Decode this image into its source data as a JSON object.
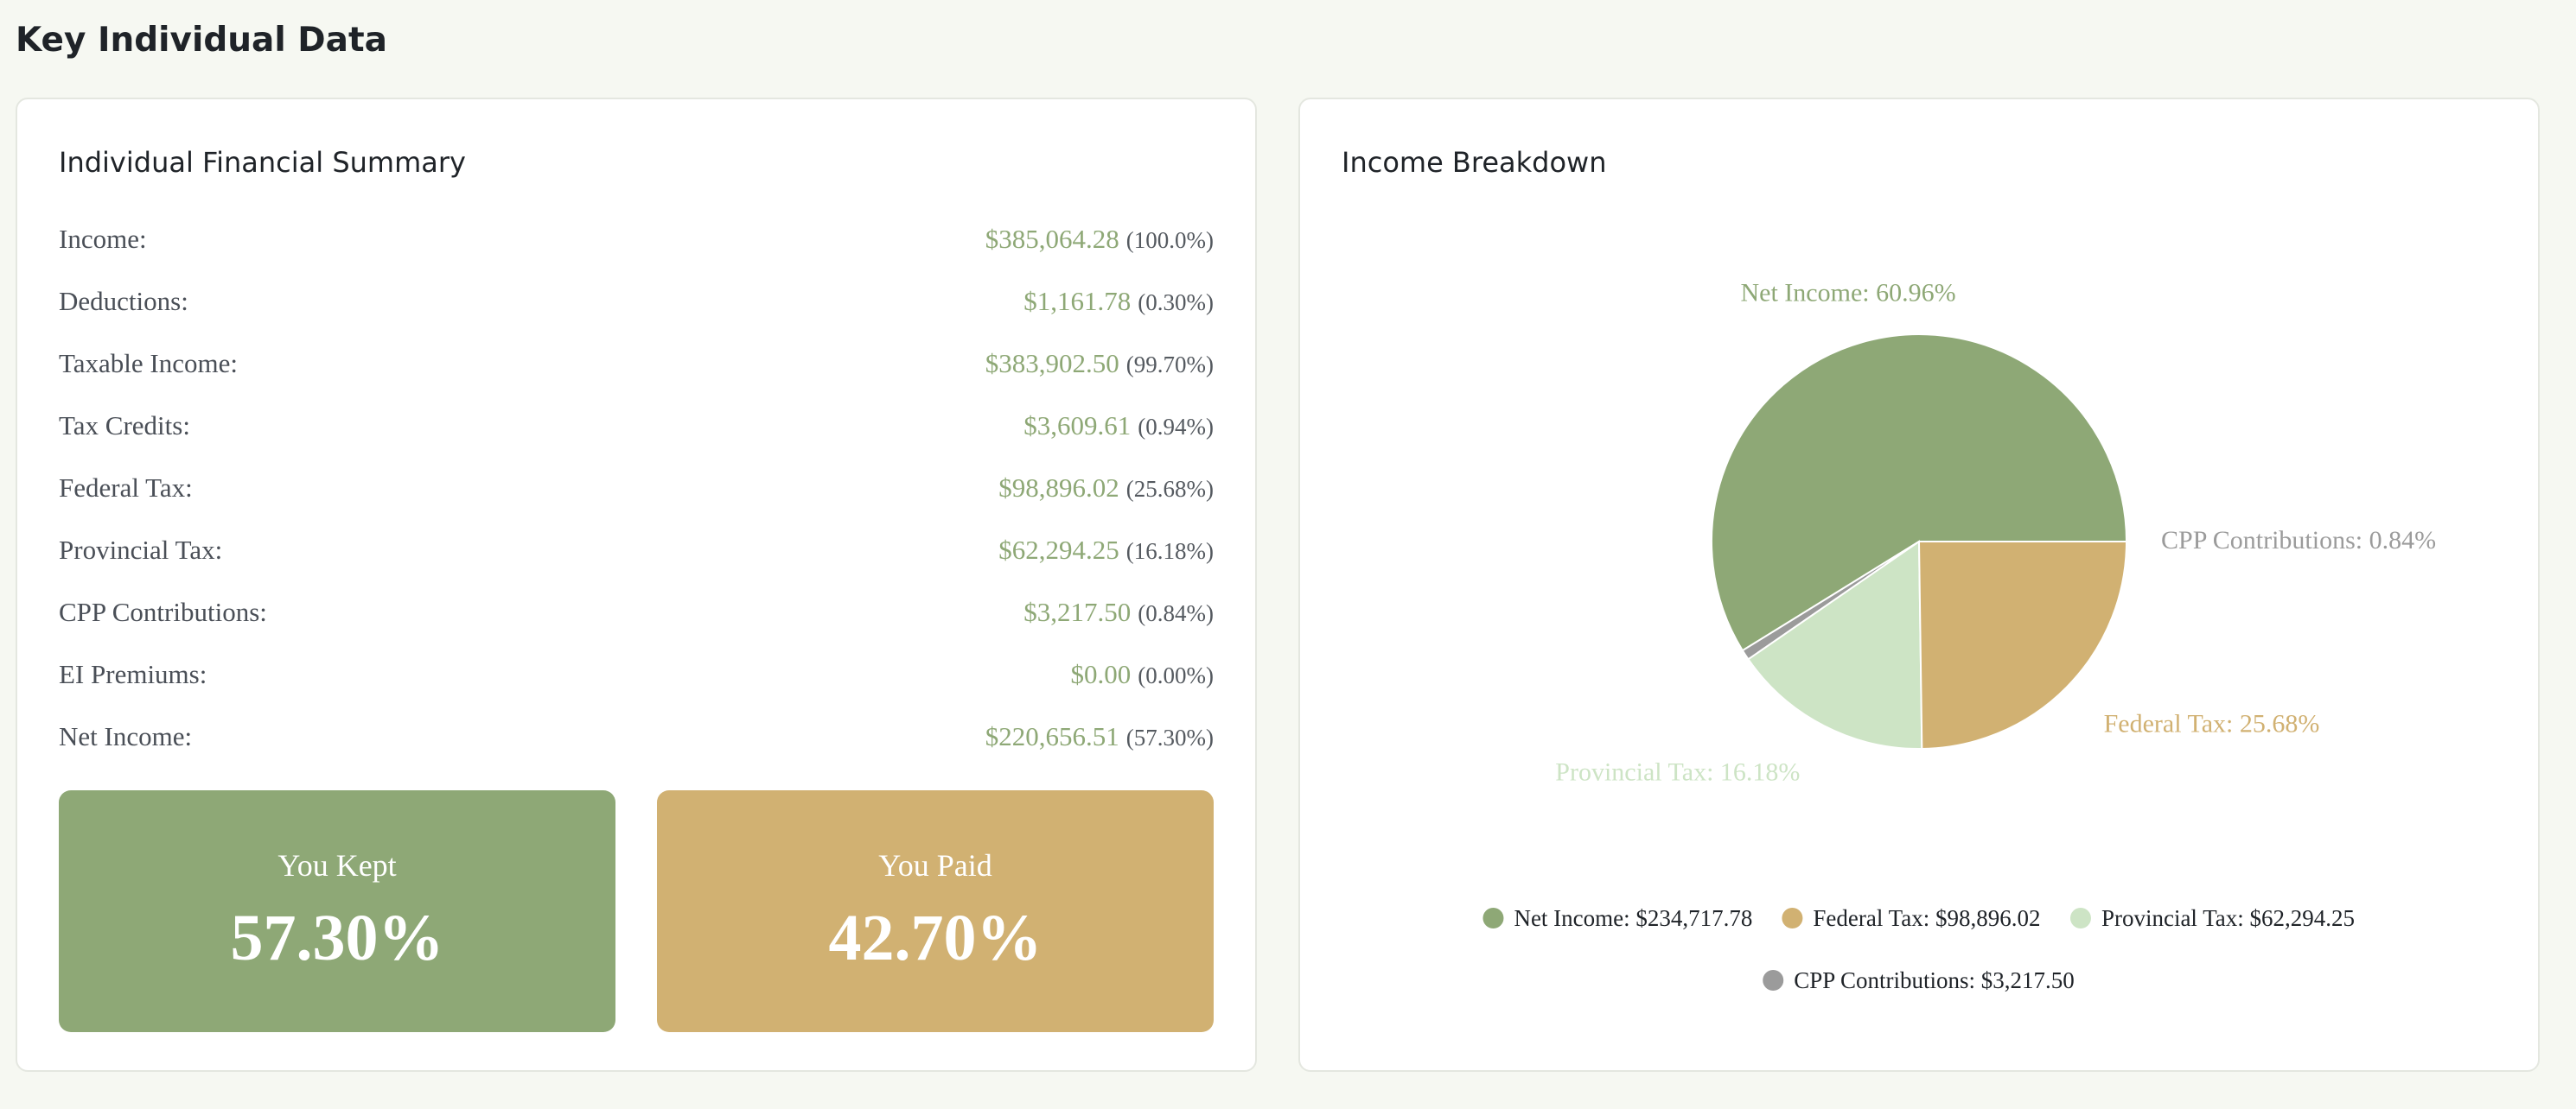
{
  "page": {
    "title": "Key Individual Data"
  },
  "summary": {
    "title": "Individual Financial Summary",
    "rows": [
      {
        "label": "Income:",
        "value": "$385,064.28",
        "pct": "(100.0%)"
      },
      {
        "label": "Deductions:",
        "value": "$1,161.78",
        "pct": "(0.30%)"
      },
      {
        "label": "Taxable Income:",
        "value": "$383,902.50",
        "pct": "(99.70%)"
      },
      {
        "label": "Tax Credits:",
        "value": "$3,609.61",
        "pct": "(0.94%)"
      },
      {
        "label": "Federal Tax:",
        "value": "$98,896.02",
        "pct": "(25.68%)"
      },
      {
        "label": "Provincial Tax:",
        "value": "$62,294.25",
        "pct": "(16.18%)"
      },
      {
        "label": "CPP Contributions:",
        "value": "$3,217.50",
        "pct": "(0.84%)"
      },
      {
        "label": "EI Premiums:",
        "value": "$0.00",
        "pct": "(0.00%)"
      },
      {
        "label": "Net Income:",
        "value": "$220,656.51",
        "pct": "(57.30%)"
      }
    ],
    "kept": {
      "label": "You Kept",
      "value": "57.30%"
    },
    "paid": {
      "label": "You Paid",
      "value": "42.70%"
    }
  },
  "colors": {
    "accent_green": "#8ea876",
    "accent_gold": "#d1b172",
    "light_green": "#cde4c5",
    "gray": "#9b9b9b"
  },
  "chart_data": {
    "type": "pie",
    "title": "Income Breakdown",
    "slices": [
      {
        "name": "Net Income",
        "value": 234717.78,
        "pct": 60.96,
        "label": "Net Income: 60.96%",
        "legend": "Net Income: $234,717.78",
        "color": "#8ea876"
      },
      {
        "name": "CPP Contributions",
        "value": 3217.5,
        "pct": 0.84,
        "label": "CPP Contributions: 0.84%",
        "legend": "CPP Contributions: $3,217.50",
        "color": "#9b9b9b"
      },
      {
        "name": "Provincial Tax",
        "value": 62294.25,
        "pct": 16.18,
        "label": "Provincial Tax: 16.18%",
        "legend": "Provincial Tax: $62,294.25",
        "color": "#cde4c5"
      },
      {
        "name": "Federal Tax",
        "value": 98896.02,
        "pct": 25.68,
        "label": "Federal Tax: 25.68%",
        "legend": "Federal Tax: $98,896.02",
        "color": "#d1b172"
      }
    ],
    "legend_order": [
      "Net Income",
      "Federal Tax",
      "Provincial Tax",
      "CPP Contributions"
    ],
    "legend_position": "bottom"
  }
}
